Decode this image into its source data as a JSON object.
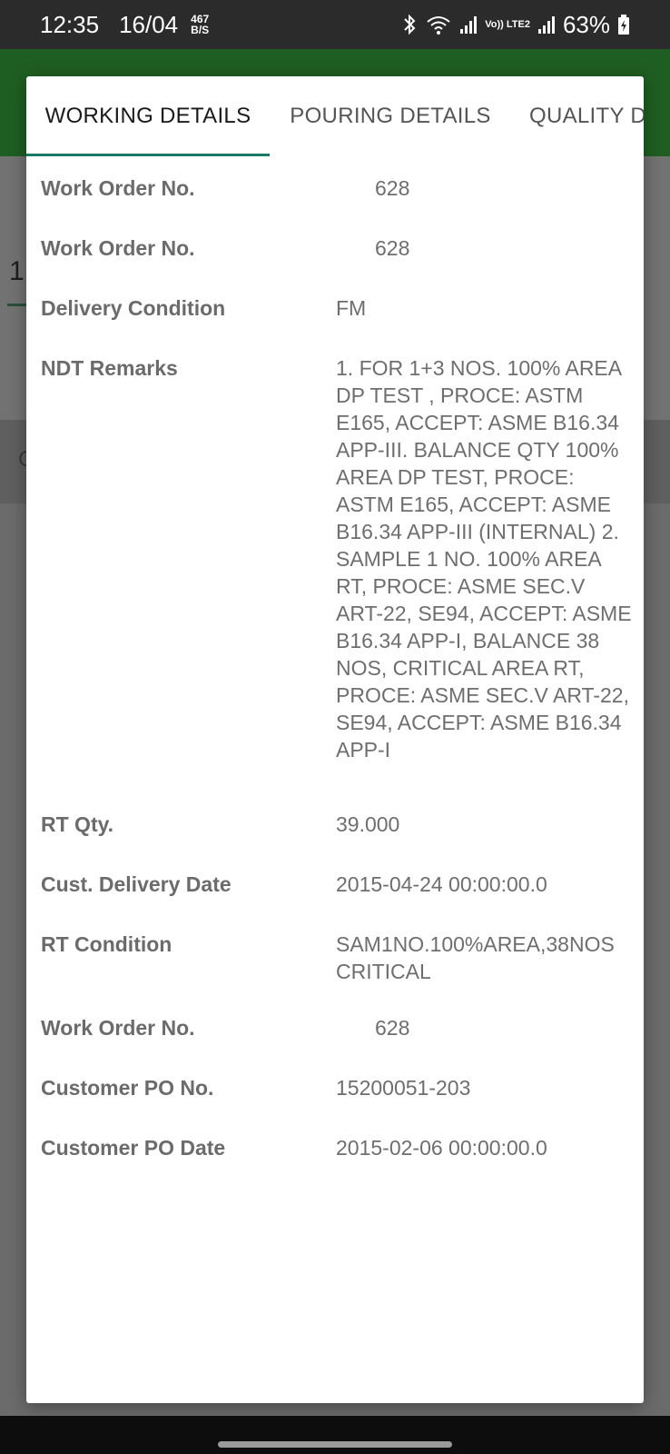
{
  "status_bar": {
    "time": "12:35",
    "date": "16/04",
    "speed_value": "467",
    "speed_unit": "B/S",
    "volte": "Vo)) LTE2",
    "battery": "63%"
  },
  "tabs": [
    {
      "label": "WORKING DETAILS",
      "active": true
    },
    {
      "label": "POURING DETAILS",
      "active": false
    },
    {
      "label": "QUALITY D",
      "active": false
    }
  ],
  "background": {
    "field_char": "1",
    "band_char": "C"
  },
  "details": [
    {
      "label": "Work Order No.",
      "value": "628"
    },
    {
      "label": "Work Order No.",
      "value": "628"
    },
    {
      "label": "Delivery Condition",
      "value": "FM"
    },
    {
      "label": "NDT Remarks",
      "value": "1. FOR 1+3 NOS. 100% AREA DP TEST , PROCE: ASTM E165, ACCEPT: ASME B16.34 APP-III. BALANCE QTY 100% AREA DP TEST, PROCE: ASTM E165, ACCEPT: ASME B16.34 APP-III (INTERNAL) 2. SAMPLE 1 NO. 100% AREA RT, PROCE: ASME SEC.V ART-22, SE94, ACCEPT: ASME B16.34 APP-I, BALANCE 38 NOS, CRITICAL AREA RT, PROCE: ASME SEC.V ART-22, SE94, ACCEPT: ASME B16.34 APP-I"
    },
    {
      "label": "RT Qty.",
      "value": "39.000"
    },
    {
      "label": "Cust. Delivery Date",
      "value": "2015-04-24 00:00:00.0"
    },
    {
      "label": "RT Condition",
      "value": "SAM1NO.100%AREA,38NOS CRITICAL"
    },
    {
      "label": "Work Order No.",
      "value": "628"
    },
    {
      "label": "Customer PO No.",
      "value": "15200051-203"
    },
    {
      "label": "Customer PO Date",
      "value": "2015-02-06 00:00:00.0"
    }
  ],
  "colors": {
    "toolbar_green": "#1f5e22",
    "tab_indicator": "#1b7a66"
  }
}
